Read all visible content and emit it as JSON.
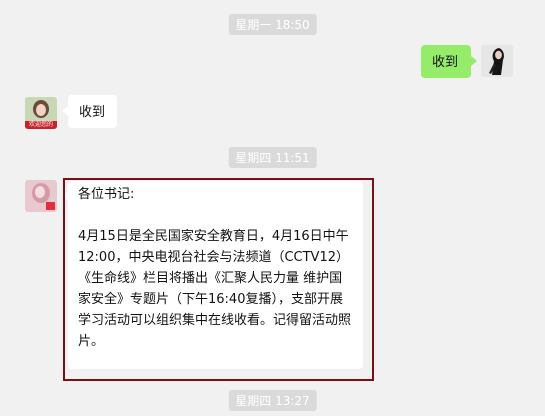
{
  "timestamps": [
    "星期一 18:50",
    "星期四 11:51",
    "星期四 13:27"
  ],
  "messages": {
    "m1_text": "收到",
    "m2_text": "收到",
    "m3_text": "各位书记:\n\n4月15日是全民国家安全教育日，4月16日中午12:00，中央电视台社会与法频道（CCTV12）《生命线》栏目将播出《汇聚人民力量 维护国家安全》专题片（下午16:40复播），支部开展学习活动可以组织集中在线收看。记得留活动照片。"
  },
  "avatar_badge": "欢迎您的",
  "colors": {
    "self_bubble": "#95ec69",
    "other_bubble": "#ffffff",
    "highlight": "#7a0f14",
    "timestamp_bg": "#dadada"
  }
}
